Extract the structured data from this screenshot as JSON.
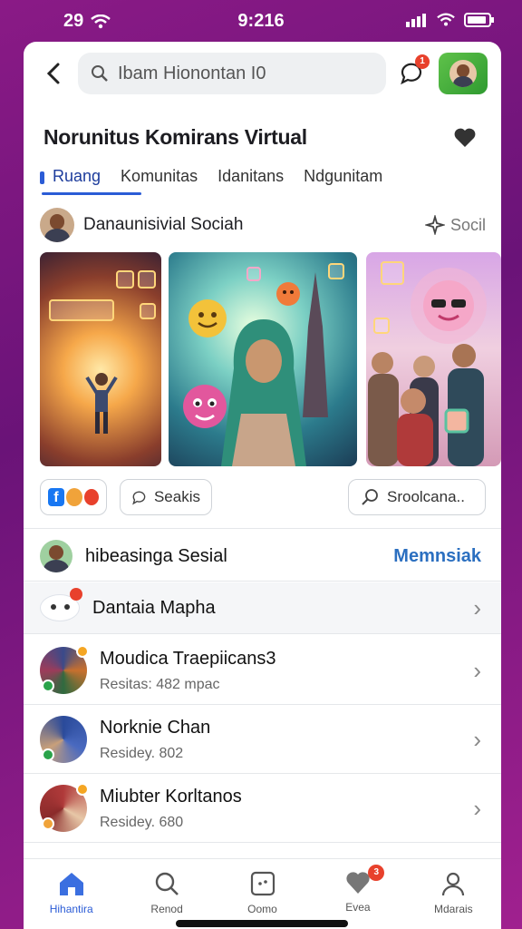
{
  "status": {
    "left": "29",
    "time": "9:216"
  },
  "header": {
    "search_placeholder": "Ibam Hionontan I0",
    "message_badge": "1",
    "title": "Norunitus Komirans Virtual"
  },
  "tabs": [
    {
      "label": "Ruang"
    },
    {
      "label": "Komunitas"
    },
    {
      "label": "Idanitans"
    },
    {
      "label": "Ndgunitam"
    }
  ],
  "feature": {
    "author": "Danaunisivial Sociah",
    "soc_label": "Socil"
  },
  "actions": {
    "seeks": "Seakis",
    "search": "Sroolcana.."
  },
  "list": {
    "header": {
      "name": "hibeasinga Sesial",
      "action": "Memnsiak"
    },
    "items": [
      {
        "name": "Dantaia Mapha",
        "sub": ""
      },
      {
        "name": "Moudica Traepiicans3",
        "sub": "Resitas: 482 mpac"
      },
      {
        "name": "Norknie Chan",
        "sub": "Residey. 802"
      },
      {
        "name": "Miubter Korltanos",
        "sub": "Residey. 680"
      }
    ]
  },
  "nav": [
    {
      "label": "Hihantira",
      "icon": "home-icon"
    },
    {
      "label": "Renod",
      "icon": "search-icon"
    },
    {
      "label": "Oomo",
      "icon": "grid-icon"
    },
    {
      "label": "Evea",
      "icon": "heart-icon",
      "badge": "3"
    },
    {
      "label": "Mdarais",
      "icon": "person-icon"
    }
  ],
  "colors": {
    "accent": "#2b5cd6",
    "link": "#2b6fc0",
    "badge": "#e8412c",
    "background": "#8a1a86"
  }
}
